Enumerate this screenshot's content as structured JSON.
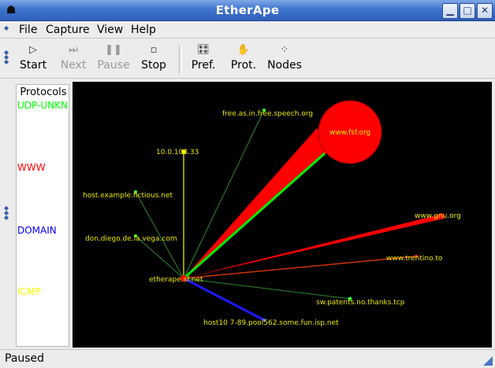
{
  "window": {
    "title": "EtherApe"
  },
  "menu": [
    "File",
    "Capture",
    "View",
    "Help"
  ],
  "toolbar": {
    "start": "Start",
    "next": "Next",
    "pause": "Pause",
    "stop": "Stop",
    "pref": "Pref.",
    "prot": "Prot.",
    "nodes": "Nodes"
  },
  "protocols": {
    "header": "Protocols",
    "items": [
      {
        "name": "UDP-UNKN",
        "color": "#00ff00"
      },
      {
        "name": "WWW",
        "color": "#ff0000"
      },
      {
        "name": "DOMAIN",
        "color": "#0000ff"
      },
      {
        "name": "ICMP",
        "color": "#ffff00"
      }
    ]
  },
  "graph": {
    "center": "etherape.sf.net",
    "nodes": [
      "free.as.in.free.speech.org",
      "www.fsf.org",
      "10.0.108.33",
      "host.example.fictious.net",
      "don.diego.de.la.vega.com",
      "www.gnu.org",
      "www.trentino.to",
      "sw.patents.no.thanks.tcp",
      "host10 7-89.pool562.some.fun.isp.net"
    ]
  },
  "status": "Paused"
}
